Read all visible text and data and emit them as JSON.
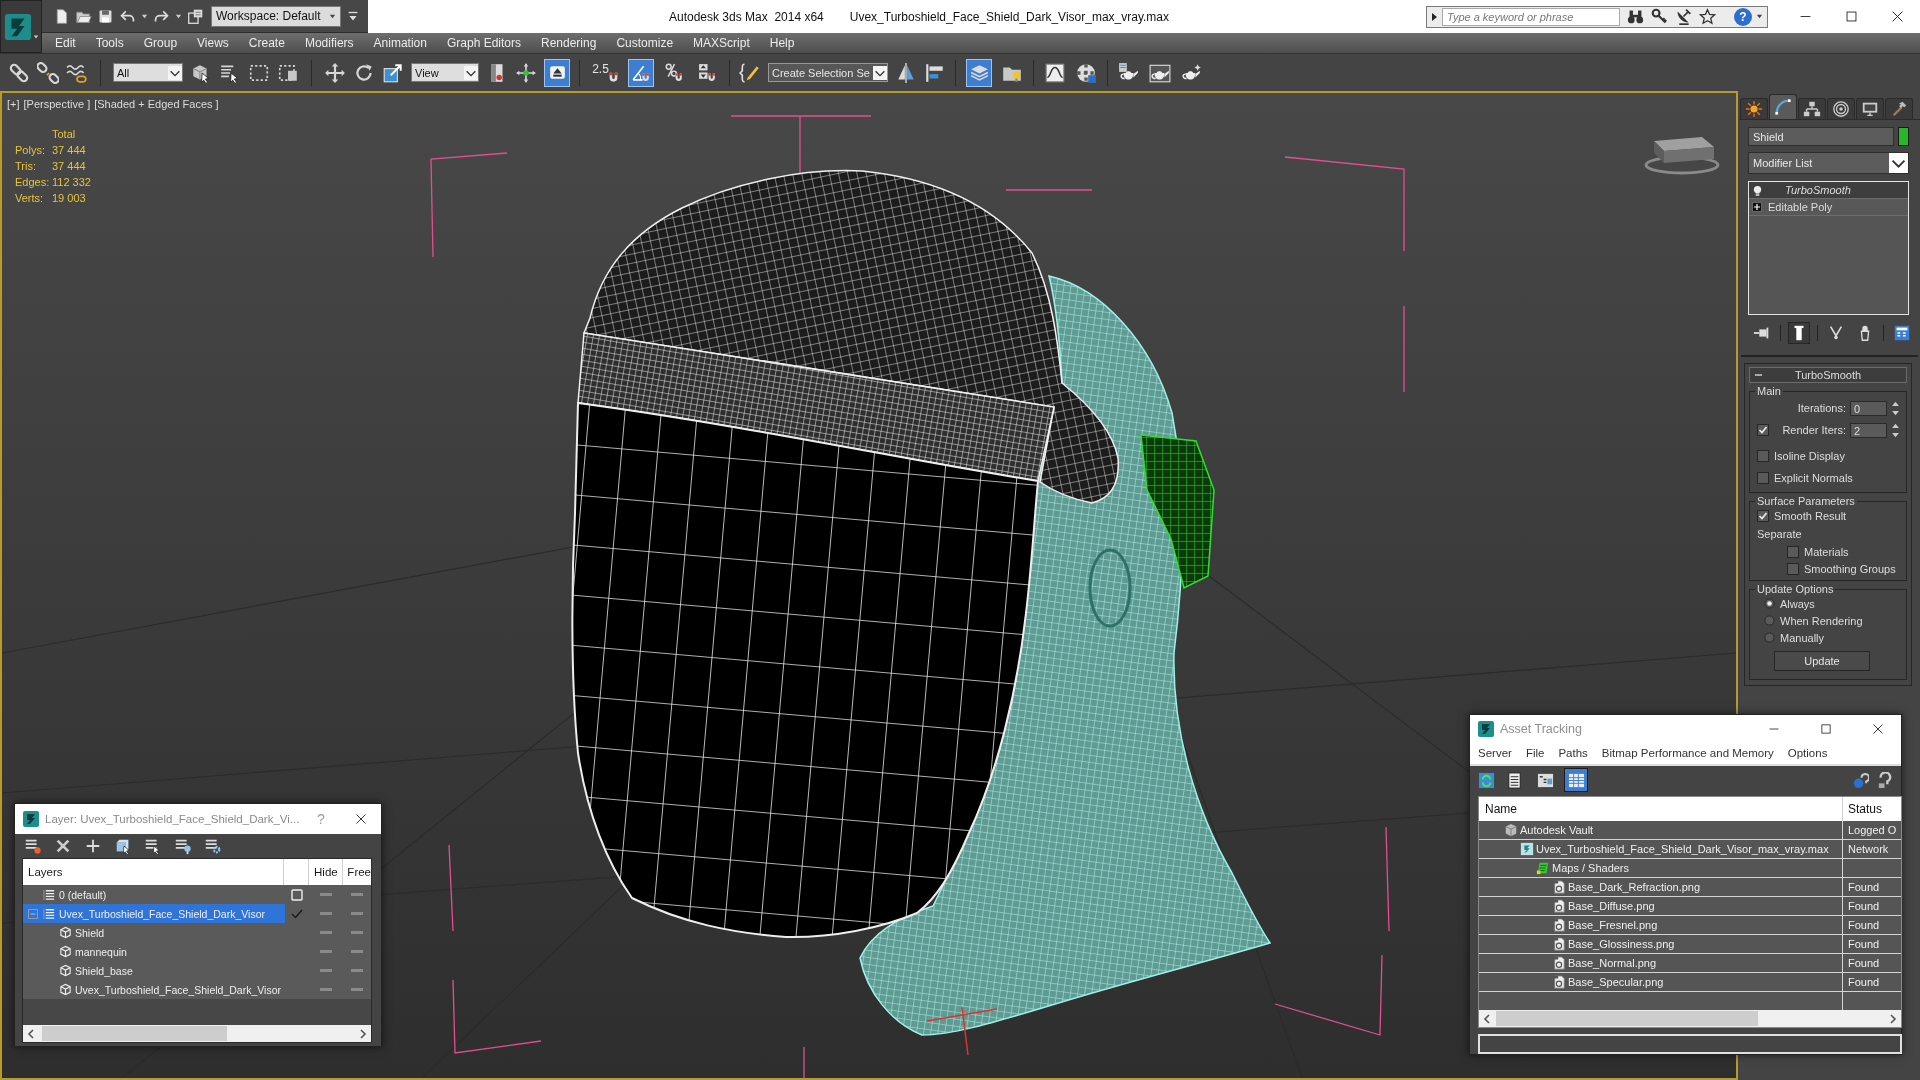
{
  "title_bar": {
    "workspace": "Workspace: Default",
    "app_title": "Autodesk 3ds Max  2014 x64",
    "document": "Uvex_Turboshield_Face_Shield_Dark_Visor_max_vray.max",
    "search": {
      "placeholder": "Type a keyword or phrase"
    },
    "help_button": "?"
  },
  "menu": [
    "Edit",
    "Tools",
    "Group",
    "Views",
    "Create",
    "Modifiers",
    "Animation",
    "Graph Editors",
    "Rendering",
    "Customize",
    "MAXScript",
    "Help"
  ],
  "main_toolbar": {
    "selection_filter": "All",
    "reference_coordinate_system": "View",
    "keyboard_shortcut_override": {
      "on": true
    },
    "snaps_toggle": {
      "label": "2.5",
      "on": false
    },
    "angle_snap_toggle": {
      "on": true
    },
    "percent_snap_toggle": {
      "on": false
    },
    "spinner_snap_toggle": {
      "on": false
    },
    "named_selection_set": "Create Selection Se",
    "layers_toggle": {
      "on": true
    }
  },
  "viewport": {
    "labels": [
      "[+]",
      "[Perspective ]",
      "[Shaded + Edged Faces ]"
    ],
    "stats": {
      "header": "Total",
      "rows": [
        {
          "label": "Polys:",
          "value": "37 444"
        },
        {
          "label": "Tris:",
          "value": "37 444"
        },
        {
          "label": "Edges:",
          "value": "112 332"
        },
        {
          "label": "Verts:",
          "value": "19 003"
        }
      ]
    }
  },
  "command_panel": {
    "tabs": [
      {
        "selected": false
      },
      {
        "selected": true
      },
      {
        "selected": false
      },
      {
        "selected": false
      },
      {
        "selected": false
      },
      {
        "selected": false
      }
    ],
    "object_name": "Shield",
    "modifier_list": "Modifier List",
    "stack": [
      {
        "kind": "modifier",
        "name": "TurboSmooth",
        "selected": true
      },
      {
        "kind": "base_object",
        "name": "Editable Poly",
        "selected": false
      }
    ],
    "pin_stack": {
      "on": false
    },
    "show_end_result": {
      "on": true
    },
    "rollout": {
      "title": "TurboSmooth",
      "expanded": true,
      "groups": [
        {
          "title": "Main",
          "controls": [
            {
              "kind": "spinner",
              "label": "Iterations:",
              "value": "0"
            },
            {
              "kind": "check_spinner",
              "label": "Render Iters:",
              "checked": true,
              "value": "2"
            },
            {
              "kind": "checkbox",
              "label": "Isoline Display",
              "checked": false
            },
            {
              "kind": "checkbox",
              "label": "Explicit Normals",
              "checked": false
            }
          ]
        },
        {
          "title": "Surface Parameters",
          "controls": [
            {
              "kind": "checkbox",
              "label": "Smooth Result",
              "checked": true
            },
            {
              "kind": "label",
              "label": "Separate",
              "children": [
                {
                  "kind": "checkbox",
                  "label": "Materials",
                  "checked": false
                },
                {
                  "kind": "checkbox",
                  "label": "Smoothing Groups",
                  "checked": false
                }
              ]
            }
          ]
        },
        {
          "title": "Update Options",
          "controls": [
            {
              "kind": "radio",
              "label": "Always",
              "selected": true
            },
            {
              "kind": "radio",
              "label": "When Rendering",
              "selected": false
            },
            {
              "kind": "radio",
              "label": "Manually",
              "selected": false
            },
            {
              "kind": "button",
              "label": "Update"
            }
          ]
        }
      ]
    }
  },
  "layer_dialog": {
    "title": "Layer: Uvex_Turboshield_Face_Shield_Dark_Vi...",
    "help_button": "?",
    "columns": {
      "name": "Layers",
      "hide": "Hide",
      "freeze": "Free"
    },
    "layers": [
      {
        "name": "0 (default)",
        "selected": false,
        "current": false,
        "hidden": false,
        "frozen": false
      },
      {
        "name": "Uvex_Turboshield_Face_Shield_Dark_Visor",
        "selected": true,
        "current": true,
        "expanded": true,
        "hidden": false,
        "frozen": false,
        "children": [
          {
            "name": "Shield",
            "selected": false,
            "hidden": false,
            "frozen": false
          },
          {
            "name": "mannequin",
            "selected": false,
            "hidden": false,
            "frozen": false
          },
          {
            "name": "Shield_base",
            "selected": false,
            "hidden": false,
            "frozen": false
          },
          {
            "name": "Uvex_Turboshield_Face_Shield_Dark_Visor",
            "selected": false,
            "hidden": false,
            "frozen": false
          }
        ]
      }
    ]
  },
  "asset_tracking": {
    "title": "Asset Tracking",
    "menu": [
      "Server",
      "File",
      "Paths",
      "Bitmap Performance and Memory",
      "Options"
    ],
    "view_modes": [
      {
        "selected": false
      },
      {
        "selected": false
      },
      {
        "selected": true
      }
    ],
    "columns": [
      "Name",
      "Status"
    ],
    "rows": [
      {
        "kind": "server",
        "name": "Autodesk Vault",
        "status": "Logged O",
        "children": [
          {
            "kind": "scene",
            "name": "Uvex_Turboshield_Face_Shield_Dark_Visor_max_vray.max",
            "status": "Network",
            "children": [
              {
                "kind": "folder",
                "name": "Maps / Shaders",
                "children": [
                  {
                    "kind": "bitmap",
                    "name": "Base_Dark_Refraction.png",
                    "status": "Found"
                  },
                  {
                    "kind": "bitmap",
                    "name": "Base_Diffuse.png",
                    "status": "Found"
                  },
                  {
                    "kind": "bitmap",
                    "name": "Base_Fresnel.png",
                    "status": "Found"
                  },
                  {
                    "kind": "bitmap",
                    "name": "Base_Glossiness.png",
                    "status": "Found"
                  },
                  {
                    "kind": "bitmap",
                    "name": "Base_Normal.png",
                    "status": "Found"
                  },
                  {
                    "kind": "bitmap",
                    "name": "Base_Specular.png",
                    "status": "Found"
                  }
                ]
              }
            ]
          }
        ]
      }
    ]
  }
}
